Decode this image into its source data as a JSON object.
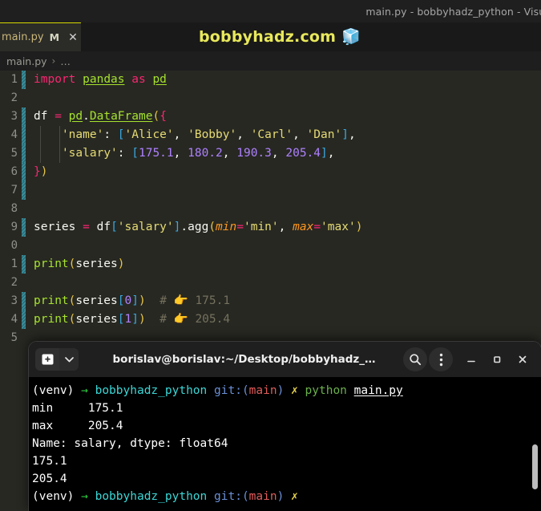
{
  "window": {
    "title": "main.py - bobbyhadz_python - Visua"
  },
  "tab": {
    "filename": "main.py",
    "dirty_indicator": "M",
    "close_icon": "✕"
  },
  "watermark": {
    "text": "bobbyhadz.com",
    "emoji": "🧊"
  },
  "breadcrumb": {
    "file": "main.py",
    "separator": "›",
    "ellipsis": "…"
  },
  "editor": {
    "lines": [
      {
        "no": "1",
        "diff": true,
        "text": "import pandas as pd"
      },
      {
        "no": "2",
        "diff": false,
        "text": ""
      },
      {
        "no": "3",
        "diff": true,
        "text": "df = pd.DataFrame({"
      },
      {
        "no": "4",
        "diff": true,
        "text": "    'name': ['Alice', 'Bobby', 'Carl', 'Dan'],"
      },
      {
        "no": "5",
        "diff": true,
        "text": "    'salary': [175.1, 180.2, 190.3, 205.4],"
      },
      {
        "no": "6",
        "diff": true,
        "text": "})"
      },
      {
        "no": "7",
        "diff": true,
        "text": ""
      },
      {
        "no": "8",
        "diff": false,
        "text": ""
      },
      {
        "no": "9",
        "diff": true,
        "text": "series = df['salary'].agg(min='min', max='max')"
      },
      {
        "no": "0",
        "diff": false,
        "text": ""
      },
      {
        "no": "1",
        "diff": true,
        "text": "print(series)"
      },
      {
        "no": "2",
        "diff": false,
        "text": ""
      },
      {
        "no": "3",
        "diff": true,
        "text": "print(series[0])  # 👉 175.1"
      },
      {
        "no": "4",
        "diff": true,
        "text": "print(series[1])  # 👉 205.4"
      },
      {
        "no": "5",
        "diff": false,
        "text": ""
      }
    ],
    "comment_marker": "#",
    "comment_emoji": "👉",
    "comment_value_1": "175.1",
    "comment_value_2": "205.4"
  },
  "terminal": {
    "title": "borislav@borislav:~/Desktop/bobbyhadz_…",
    "new_tab_icon": "terminal-plus-icon",
    "caret_icon": "▾",
    "search_icon": "search-icon",
    "menu_icon": "⋮",
    "minimize_icon": "–",
    "maximize_icon": "□",
    "close_icon": "✕",
    "prompt": {
      "venv": "(venv)",
      "arrow": "→",
      "dir": "bobbyhadz_python",
      "git_word": "git:",
      "branch_open": "(",
      "branch": "main",
      "branch_close": ")",
      "status": "✗"
    },
    "command": {
      "interpreter": "python",
      "script": "main.py"
    },
    "output": [
      "min     175.1",
      "max     205.4",
      "Name: salary, dtype: float64",
      "175.1",
      "205.4"
    ]
  },
  "colors": {
    "editor_bg": "#272822",
    "accent_tab": "#d7d700",
    "watermark": "#e8e85c",
    "terminal_bg": "#000000"
  }
}
